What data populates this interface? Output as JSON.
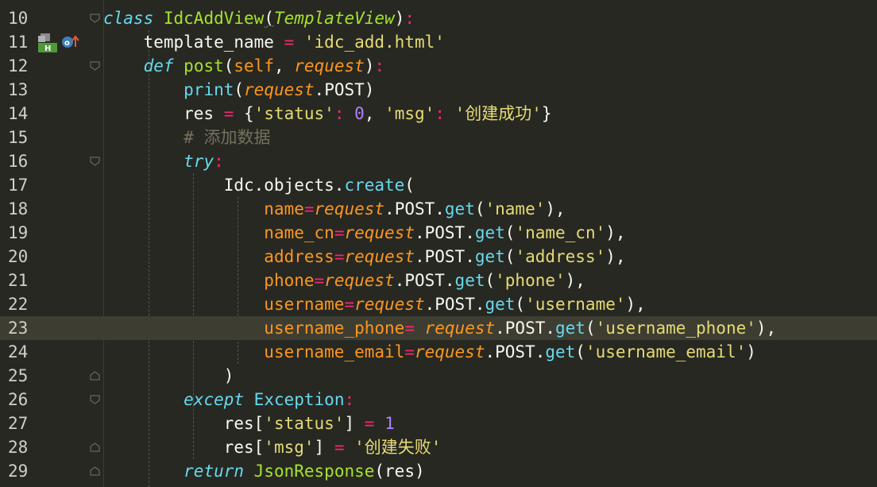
{
  "editor": {
    "theme": "monokai",
    "current_line": 23,
    "lines": [
      {
        "num": "10",
        "parts": [
          [
            "kw",
            "class"
          ],
          [
            "p",
            " "
          ],
          [
            "cls",
            "IdcAddView"
          ],
          [
            "p",
            "("
          ],
          [
            "inh",
            "TemplateView"
          ],
          [
            "p",
            ")"
          ],
          [
            "op",
            ":"
          ]
        ]
      },
      {
        "num": "11",
        "parts": [
          [
            "p",
            "    template_name "
          ],
          [
            "op",
            "="
          ],
          [
            "p",
            " "
          ],
          [
            "str",
            "'idc_add.html'"
          ]
        ]
      },
      {
        "num": "12",
        "parts": [
          [
            "p",
            "    "
          ],
          [
            "kw",
            "def"
          ],
          [
            "p",
            " "
          ],
          [
            "fn",
            "post"
          ],
          [
            "p",
            "("
          ],
          [
            "self",
            "self"
          ],
          [
            "p",
            ", "
          ],
          [
            "par",
            "request"
          ],
          [
            "p",
            ")"
          ],
          [
            "op",
            ":"
          ]
        ]
      },
      {
        "num": "13",
        "parts": [
          [
            "p",
            "        "
          ],
          [
            "bi",
            "print"
          ],
          [
            "p",
            "("
          ],
          [
            "par",
            "request"
          ],
          [
            "p",
            ".POST)"
          ]
        ]
      },
      {
        "num": "14",
        "parts": [
          [
            "p",
            "        res "
          ],
          [
            "op",
            "="
          ],
          [
            "p",
            " {"
          ],
          [
            "str",
            "'status'"
          ],
          [
            "op",
            ":"
          ],
          [
            "p",
            " "
          ],
          [
            "num",
            "0"
          ],
          [
            "p",
            ", "
          ],
          [
            "str",
            "'msg'"
          ],
          [
            "op",
            ":"
          ],
          [
            "p",
            " "
          ],
          [
            "str",
            "'创建成功'"
          ],
          [
            "p",
            "}"
          ]
        ]
      },
      {
        "num": "15",
        "parts": [
          [
            "p",
            "        "
          ],
          [
            "cm",
            "# 添加数据"
          ]
        ]
      },
      {
        "num": "16",
        "parts": [
          [
            "p",
            "        "
          ],
          [
            "kw",
            "try"
          ],
          [
            "op",
            ":"
          ]
        ]
      },
      {
        "num": "17",
        "parts": [
          [
            "p",
            "            Idc.objects."
          ],
          [
            "meth",
            "create"
          ],
          [
            "p",
            "("
          ]
        ]
      },
      {
        "num": "18",
        "parts": [
          [
            "p",
            "                "
          ],
          [
            "kwa",
            "name"
          ],
          [
            "op",
            "="
          ],
          [
            "par",
            "request"
          ],
          [
            "p",
            ".POST."
          ],
          [
            "meth",
            "get"
          ],
          [
            "p",
            "("
          ],
          [
            "str",
            "'name'"
          ],
          [
            "p",
            "),"
          ]
        ]
      },
      {
        "num": "19",
        "parts": [
          [
            "p",
            "                "
          ],
          [
            "kwa",
            "name_cn"
          ],
          [
            "op",
            "="
          ],
          [
            "par",
            "request"
          ],
          [
            "p",
            ".POST."
          ],
          [
            "meth",
            "get"
          ],
          [
            "p",
            "("
          ],
          [
            "str",
            "'name_cn'"
          ],
          [
            "p",
            "),"
          ]
        ]
      },
      {
        "num": "20",
        "parts": [
          [
            "p",
            "                "
          ],
          [
            "kwa",
            "address"
          ],
          [
            "op",
            "="
          ],
          [
            "par",
            "request"
          ],
          [
            "p",
            ".POST."
          ],
          [
            "meth",
            "get"
          ],
          [
            "p",
            "("
          ],
          [
            "str",
            "'address'"
          ],
          [
            "p",
            "),"
          ]
        ]
      },
      {
        "num": "21",
        "parts": [
          [
            "p",
            "                "
          ],
          [
            "kwa",
            "phone"
          ],
          [
            "op",
            "="
          ],
          [
            "par",
            "request"
          ],
          [
            "p",
            ".POST."
          ],
          [
            "meth",
            "get"
          ],
          [
            "p",
            "("
          ],
          [
            "str",
            "'phone'"
          ],
          [
            "p",
            "),"
          ]
        ]
      },
      {
        "num": "22",
        "parts": [
          [
            "p",
            "                "
          ],
          [
            "kwa",
            "username"
          ],
          [
            "op",
            "="
          ],
          [
            "par",
            "request"
          ],
          [
            "p",
            ".POST."
          ],
          [
            "meth",
            "get"
          ],
          [
            "p",
            "("
          ],
          [
            "str",
            "'username'"
          ],
          [
            "p",
            "),"
          ]
        ]
      },
      {
        "num": "23",
        "parts": [
          [
            "p",
            "                "
          ],
          [
            "kwa",
            "username_phone"
          ],
          [
            "op",
            "="
          ],
          [
            "p",
            " "
          ],
          [
            "par",
            "request"
          ],
          [
            "p",
            ".POST."
          ],
          [
            "meth",
            "get"
          ],
          [
            "p",
            "("
          ],
          [
            "str",
            "'username_phone'"
          ],
          [
            "p",
            "),"
          ]
        ]
      },
      {
        "num": "24",
        "parts": [
          [
            "p",
            "                "
          ],
          [
            "kwa",
            "username_email"
          ],
          [
            "op",
            "="
          ],
          [
            "par",
            "request"
          ],
          [
            "p",
            ".POST."
          ],
          [
            "meth",
            "get"
          ],
          [
            "p",
            "("
          ],
          [
            "str",
            "'username_email'"
          ],
          [
            "p",
            ")"
          ]
        ]
      },
      {
        "num": "25",
        "parts": [
          [
            "p",
            "            )"
          ]
        ]
      },
      {
        "num": "26",
        "parts": [
          [
            "p",
            "        "
          ],
          [
            "kw",
            "except"
          ],
          [
            "p",
            " "
          ],
          [
            "bi",
            "Exception"
          ],
          [
            "op",
            ":"
          ]
        ]
      },
      {
        "num": "27",
        "parts": [
          [
            "p",
            "            res["
          ],
          [
            "str",
            "'status'"
          ],
          [
            "p",
            "] "
          ],
          [
            "op",
            "="
          ],
          [
            "p",
            " "
          ],
          [
            "num",
            "1"
          ]
        ]
      },
      {
        "num": "28",
        "parts": [
          [
            "p",
            "            res["
          ],
          [
            "str",
            "'msg'"
          ],
          [
            "p",
            "] "
          ],
          [
            "op",
            "="
          ],
          [
            "p",
            " "
          ],
          [
            "str",
            "'创建失败'"
          ]
        ]
      },
      {
        "num": "29",
        "parts": [
          [
            "p",
            "        "
          ],
          [
            "kw",
            "return"
          ],
          [
            "p",
            " "
          ],
          [
            "fn",
            "JsonResponse"
          ],
          [
            "p",
            "(res)"
          ]
        ]
      }
    ]
  },
  "gutter_icons": [
    "override-marker-icon",
    "overridden-method-icon"
  ],
  "colors": {
    "background": "#272822",
    "current_line": "#3e3d32",
    "keyword": "#66d9ef",
    "function": "#a6e22e",
    "string": "#e6db74",
    "number": "#ae81ff",
    "operator": "#f92672",
    "parameter": "#fd971f",
    "comment": "#75715e"
  }
}
